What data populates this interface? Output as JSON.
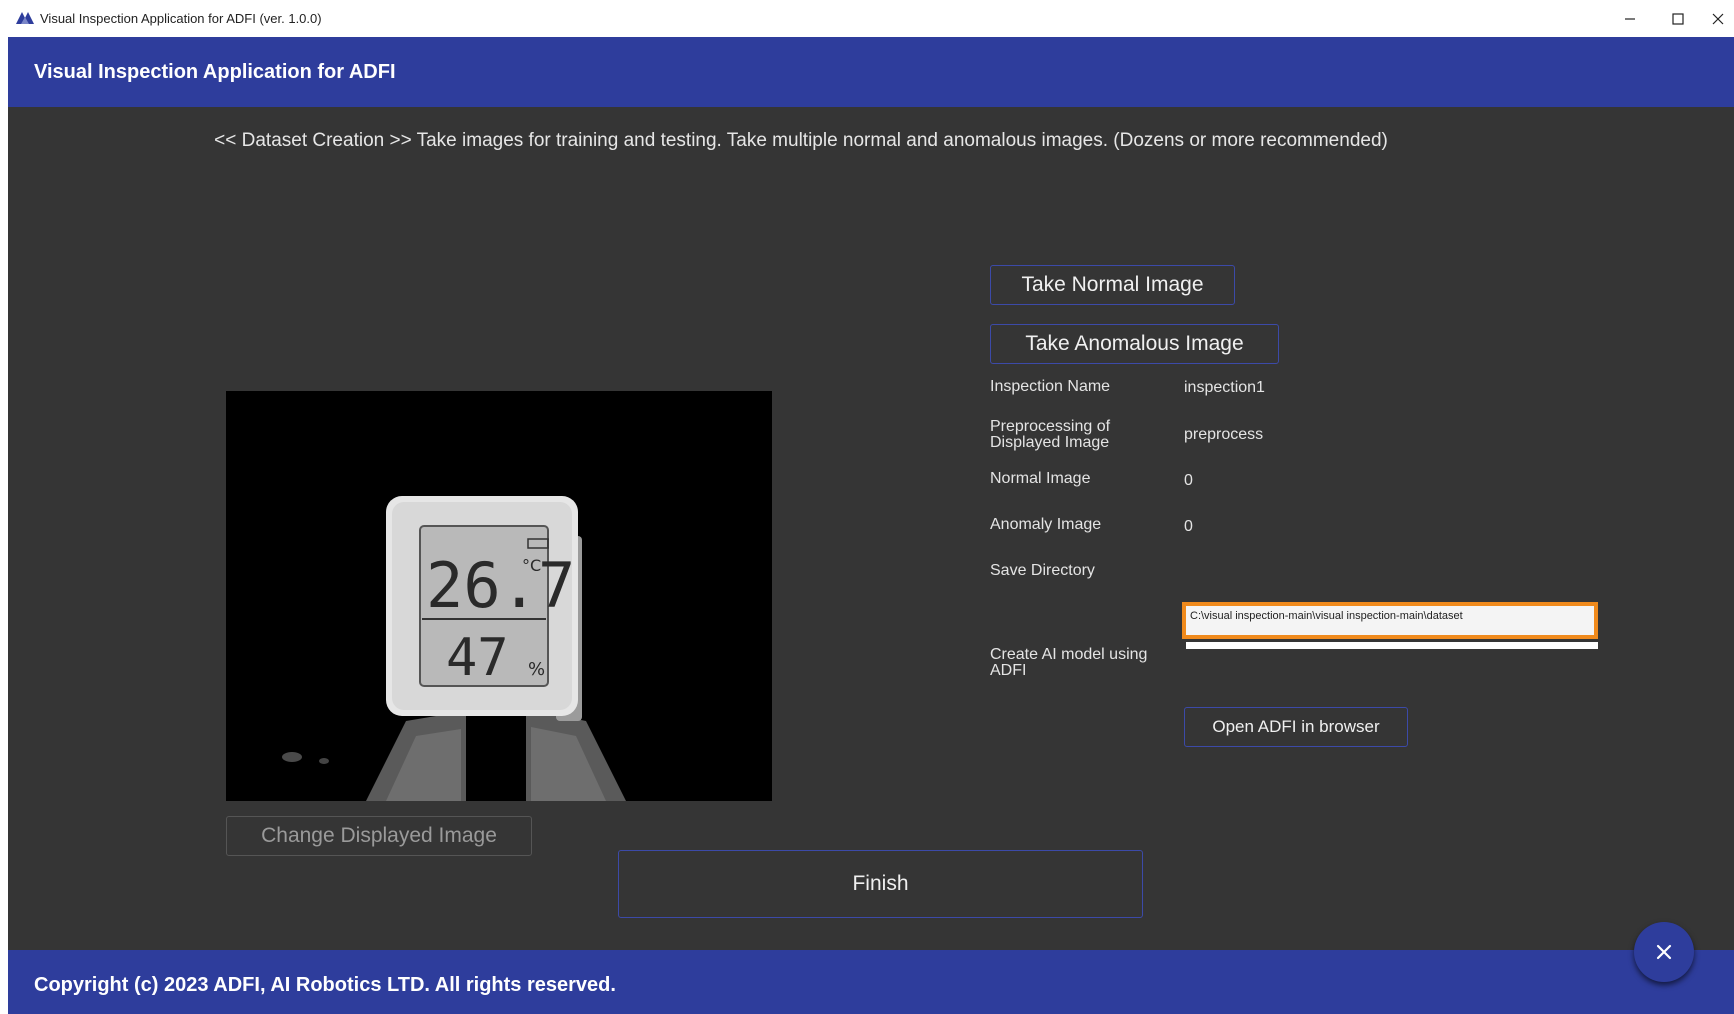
{
  "window": {
    "title": "Visual Inspection Application for ADFI (ver. 1.0.0)",
    "controls": {
      "minimize": "–",
      "maximize": "☐",
      "close": "✕"
    }
  },
  "header": {
    "title": "Visual Inspection Application for ADFI"
  },
  "main": {
    "instruction": "<< Dataset Creation >>  Take images for training and testing. Take multiple normal and anomalous images. (Dozens or more recommended)",
    "take_normal_label": "Take Normal Image",
    "take_anomalous_label": "Take Anomalous Image",
    "change_image_label": "Change Displayed Image",
    "finish_label": "Finish",
    "camera_display": {
      "temperature": "26.7",
      "temp_unit": "°C",
      "humidity": "47",
      "humidity_unit": "%"
    },
    "info": {
      "inspection_name_label": "Inspection Name",
      "inspection_name_value": "inspection1",
      "preprocessing_label": "Preprocessing of Displayed Image",
      "preprocessing_value": "preprocess",
      "normal_image_label": "Normal Image",
      "normal_image_value": "0",
      "anomaly_image_label": "Anomaly Image",
      "anomaly_image_value": "0",
      "save_directory_label": "Save Directory",
      "save_directory_value": "C:\\visual inspection-main\\visual inspection-main\\dataset",
      "create_model_label": "Create AI model using ADFI",
      "open_adfi_label": "Open ADFI in browser"
    }
  },
  "footer": {
    "copyright": "Copyright (c) 2023 ADFI, AI Robotics LTD. All rights reserved."
  },
  "fab": {
    "icon": "close-icon",
    "glyph": "✕"
  },
  "colors": {
    "brand_blue": "#2e3d9c",
    "background": "#353535",
    "highlight_orange": "#f08a1c"
  }
}
